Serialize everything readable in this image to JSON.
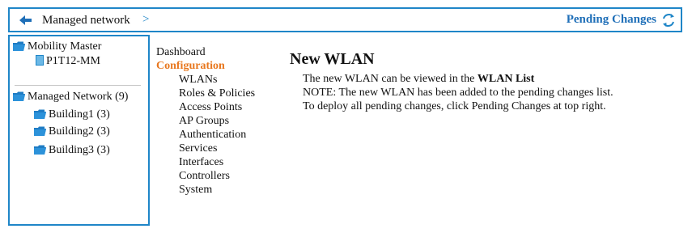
{
  "topbar": {
    "back_icon": "arrow-left-icon",
    "breadcrumb": "Managed network",
    "separator": ">",
    "pending_changes": "Pending Changes",
    "refresh_icon": "refresh-cycle-icon",
    "accent_color": "#1f86c8"
  },
  "tree": {
    "folder_icon": "folder-icon",
    "device_icon": "device-icon",
    "mobility_master": "Mobility Master",
    "device": "P1T12-MM",
    "managed_network": "Managed Network (9)",
    "groups": [
      "Building1 (3)",
      "Building2 (3)",
      "Building3 (3)"
    ]
  },
  "nav": {
    "dashboard": "Dashboard",
    "configuration": "Configuration",
    "active_color": "#e8771e",
    "items": [
      "WLANs",
      "Roles & Policies",
      "Access Points",
      "AP Groups",
      "Authentication",
      "Services",
      "Interfaces",
      "Controllers",
      "System"
    ]
  },
  "content": {
    "title": "New WLAN",
    "line1_prefix": "The new WLAN can be viewed in the",
    "line1_link": "WLAN List",
    "line2": "NOTE: The new WLAN has been added to the pending changes list.",
    "line3": "To deploy all pending changes, click Pending Changes at top right."
  }
}
